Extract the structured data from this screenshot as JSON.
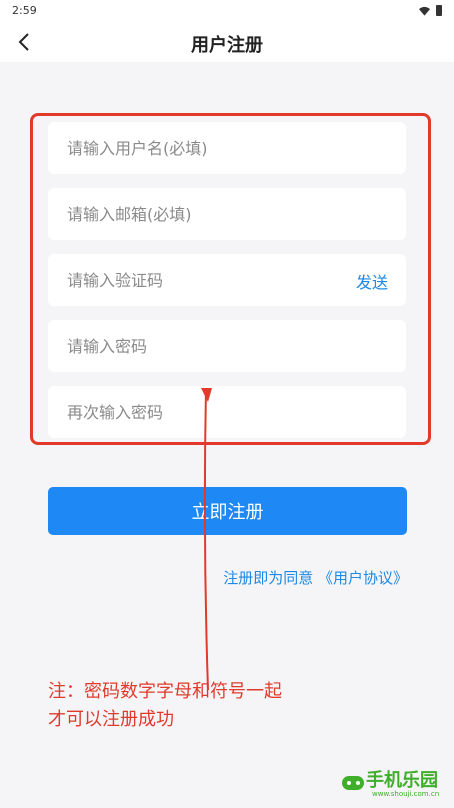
{
  "status_bar": {
    "time": "2:59"
  },
  "header": {
    "title": "用户注册"
  },
  "form": {
    "username_placeholder": "请输入用户名(必填)",
    "email_placeholder": "请输入邮箱(必填)",
    "code_placeholder": "请输入验证码",
    "send_label": "发送",
    "password_placeholder": "请输入密码",
    "confirm_placeholder": "再次输入密码"
  },
  "actions": {
    "register_label": "立即注册",
    "agreement_prefix": "注册即为同意",
    "agreement_link": "《用户协议》"
  },
  "annotation": {
    "line1": "注：密码数字字母和符号一起",
    "line2": "才可以注册成功",
    "color": "#e13a2c"
  },
  "watermark": {
    "name": "手机乐园",
    "url": "www.shouji.com.cn"
  },
  "colors": {
    "accent": "#1e88f5",
    "background": "#f5f5f7"
  }
}
